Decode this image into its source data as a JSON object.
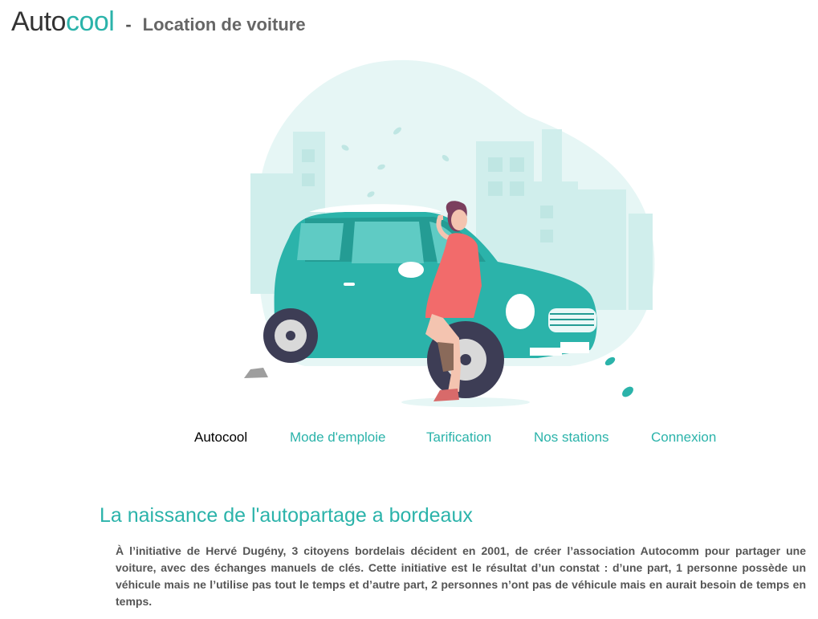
{
  "header": {
    "brand_part1": "Auto",
    "brand_part2": "cool",
    "separator": "-",
    "tagline": "Location de voiture"
  },
  "nav": {
    "items": [
      {
        "label": "Autocool",
        "active": true
      },
      {
        "label": "Mode d'emploie",
        "active": false
      },
      {
        "label": "Tarification",
        "active": false
      },
      {
        "label": "Nos stations",
        "active": false
      },
      {
        "label": "Connexion",
        "active": false
      }
    ]
  },
  "main": {
    "title": "La naissance de l'autopartage a bordeaux",
    "paragraph": "À l’initiative de Hervé Dugény, 3 citoyens bordelais décident en 2001, de créer l’association Autocomm pour partager une voiture, avec des échanges manuels de clés. Cette initiative est le résultat d’un constat : d’une part, 1 personne possède un véhicule mais ne l’utilise pas tout le temps et d’autre part, 2 personnes n’ont pas de véhicule mais en aurait besoin de temps en temps."
  },
  "colors": {
    "accent": "#2bb3aa",
    "car": "#2bb3aa",
    "dress": "#f26b6b",
    "background_blob": "#e6f6f5"
  }
}
